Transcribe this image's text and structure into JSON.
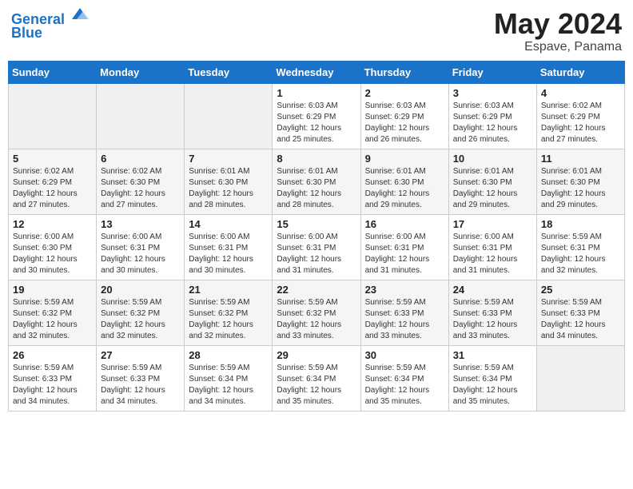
{
  "header": {
    "logo_line1": "General",
    "logo_line2": "Blue",
    "month_year": "May 2024",
    "location": "Espave, Panama"
  },
  "calendar": {
    "days_of_week": [
      "Sunday",
      "Monday",
      "Tuesday",
      "Wednesday",
      "Thursday",
      "Friday",
      "Saturday"
    ],
    "weeks": [
      [
        {
          "day": "",
          "info": ""
        },
        {
          "day": "",
          "info": ""
        },
        {
          "day": "",
          "info": ""
        },
        {
          "day": "1",
          "info": "Sunrise: 6:03 AM\nSunset: 6:29 PM\nDaylight: 12 hours and 25 minutes."
        },
        {
          "day": "2",
          "info": "Sunrise: 6:03 AM\nSunset: 6:29 PM\nDaylight: 12 hours and 26 minutes."
        },
        {
          "day": "3",
          "info": "Sunrise: 6:03 AM\nSunset: 6:29 PM\nDaylight: 12 hours and 26 minutes."
        },
        {
          "day": "4",
          "info": "Sunrise: 6:02 AM\nSunset: 6:29 PM\nDaylight: 12 hours and 27 minutes."
        }
      ],
      [
        {
          "day": "5",
          "info": "Sunrise: 6:02 AM\nSunset: 6:29 PM\nDaylight: 12 hours and 27 minutes."
        },
        {
          "day": "6",
          "info": "Sunrise: 6:02 AM\nSunset: 6:30 PM\nDaylight: 12 hours and 27 minutes."
        },
        {
          "day": "7",
          "info": "Sunrise: 6:01 AM\nSunset: 6:30 PM\nDaylight: 12 hours and 28 minutes."
        },
        {
          "day": "8",
          "info": "Sunrise: 6:01 AM\nSunset: 6:30 PM\nDaylight: 12 hours and 28 minutes."
        },
        {
          "day": "9",
          "info": "Sunrise: 6:01 AM\nSunset: 6:30 PM\nDaylight: 12 hours and 29 minutes."
        },
        {
          "day": "10",
          "info": "Sunrise: 6:01 AM\nSunset: 6:30 PM\nDaylight: 12 hours and 29 minutes."
        },
        {
          "day": "11",
          "info": "Sunrise: 6:01 AM\nSunset: 6:30 PM\nDaylight: 12 hours and 29 minutes."
        }
      ],
      [
        {
          "day": "12",
          "info": "Sunrise: 6:00 AM\nSunset: 6:30 PM\nDaylight: 12 hours and 30 minutes."
        },
        {
          "day": "13",
          "info": "Sunrise: 6:00 AM\nSunset: 6:31 PM\nDaylight: 12 hours and 30 minutes."
        },
        {
          "day": "14",
          "info": "Sunrise: 6:00 AM\nSunset: 6:31 PM\nDaylight: 12 hours and 30 minutes."
        },
        {
          "day": "15",
          "info": "Sunrise: 6:00 AM\nSunset: 6:31 PM\nDaylight: 12 hours and 31 minutes."
        },
        {
          "day": "16",
          "info": "Sunrise: 6:00 AM\nSunset: 6:31 PM\nDaylight: 12 hours and 31 minutes."
        },
        {
          "day": "17",
          "info": "Sunrise: 6:00 AM\nSunset: 6:31 PM\nDaylight: 12 hours and 31 minutes."
        },
        {
          "day": "18",
          "info": "Sunrise: 5:59 AM\nSunset: 6:31 PM\nDaylight: 12 hours and 32 minutes."
        }
      ],
      [
        {
          "day": "19",
          "info": "Sunrise: 5:59 AM\nSunset: 6:32 PM\nDaylight: 12 hours and 32 minutes."
        },
        {
          "day": "20",
          "info": "Sunrise: 5:59 AM\nSunset: 6:32 PM\nDaylight: 12 hours and 32 minutes."
        },
        {
          "day": "21",
          "info": "Sunrise: 5:59 AM\nSunset: 6:32 PM\nDaylight: 12 hours and 32 minutes."
        },
        {
          "day": "22",
          "info": "Sunrise: 5:59 AM\nSunset: 6:32 PM\nDaylight: 12 hours and 33 minutes."
        },
        {
          "day": "23",
          "info": "Sunrise: 5:59 AM\nSunset: 6:33 PM\nDaylight: 12 hours and 33 minutes."
        },
        {
          "day": "24",
          "info": "Sunrise: 5:59 AM\nSunset: 6:33 PM\nDaylight: 12 hours and 33 minutes."
        },
        {
          "day": "25",
          "info": "Sunrise: 5:59 AM\nSunset: 6:33 PM\nDaylight: 12 hours and 34 minutes."
        }
      ],
      [
        {
          "day": "26",
          "info": "Sunrise: 5:59 AM\nSunset: 6:33 PM\nDaylight: 12 hours and 34 minutes."
        },
        {
          "day": "27",
          "info": "Sunrise: 5:59 AM\nSunset: 6:33 PM\nDaylight: 12 hours and 34 minutes."
        },
        {
          "day": "28",
          "info": "Sunrise: 5:59 AM\nSunset: 6:34 PM\nDaylight: 12 hours and 34 minutes."
        },
        {
          "day": "29",
          "info": "Sunrise: 5:59 AM\nSunset: 6:34 PM\nDaylight: 12 hours and 35 minutes."
        },
        {
          "day": "30",
          "info": "Sunrise: 5:59 AM\nSunset: 6:34 PM\nDaylight: 12 hours and 35 minutes."
        },
        {
          "day": "31",
          "info": "Sunrise: 5:59 AM\nSunset: 6:34 PM\nDaylight: 12 hours and 35 minutes."
        },
        {
          "day": "",
          "info": ""
        }
      ]
    ]
  }
}
